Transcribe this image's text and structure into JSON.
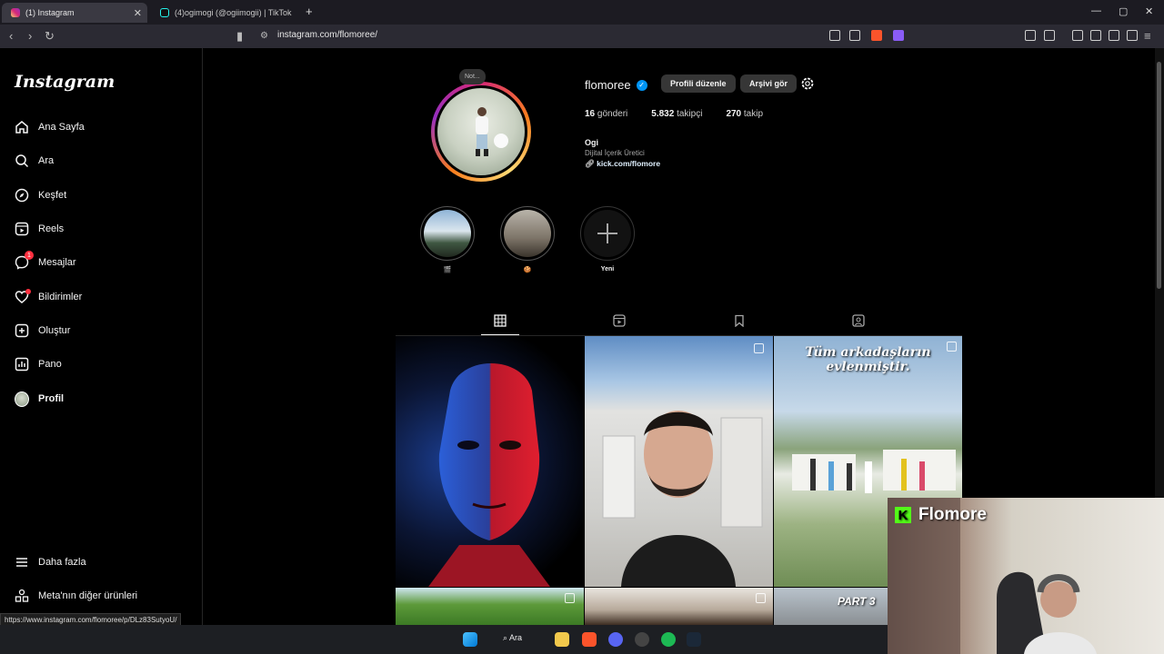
{
  "browser": {
    "tabs": [
      {
        "title": "(1) Instagram",
        "active": true
      },
      {
        "title": "(4)ogimogi (@ogiimogii) | TikTok",
        "active": false
      }
    ],
    "url": "instagram.com/flomoree/",
    "status_url": "https://www.instagram.com/flomoree/p/DLz83SutyoU/"
  },
  "sidebar": {
    "logo": "Instagram",
    "items": [
      {
        "label": "Ana Sayfa",
        "icon": "home-icon"
      },
      {
        "label": "Ara",
        "icon": "search-icon"
      },
      {
        "label": "Keşfet",
        "icon": "compass-icon"
      },
      {
        "label": "Reels",
        "icon": "reels-icon"
      },
      {
        "label": "Mesajlar",
        "icon": "messenger-icon",
        "badge": "1"
      },
      {
        "label": "Bildirimler",
        "icon": "heart-icon"
      },
      {
        "label": "Oluştur",
        "icon": "plus-square-icon"
      },
      {
        "label": "Pano",
        "icon": "dashboard-icon"
      },
      {
        "label": "Profil",
        "icon": "avatar-icon"
      }
    ],
    "more": "Daha fazla",
    "meta": "Meta'nın diğer ürünleri"
  },
  "profile": {
    "note": "Not...",
    "username": "flomoree",
    "edit_button": "Profili düzenle",
    "archive_button": "Arşivi gör",
    "posts_count": "16",
    "posts_label": "gönderi",
    "followers_count": "5.832",
    "followers_label": "takipçi",
    "following_count": "270",
    "following_label": "takip",
    "name": "Ogi",
    "category": "Dijital İçerik Üretici",
    "link": "kick.com/flomore"
  },
  "highlights": [
    {
      "label": "🎬"
    },
    {
      "label": "🍪"
    },
    {
      "label": "Yeni"
    }
  ],
  "posts": {
    "caption_1": "Tüm arkadaşların evlenmiştir.",
    "caption_2": "PART 3"
  },
  "webcam": {
    "title": "Flomore",
    "brand_letter": "K"
  },
  "taskbar": {
    "search_label": "Ara"
  },
  "colors": {
    "accent": "#0095f6",
    "badge": "#ff3040",
    "kick_green": "#53fc18"
  }
}
